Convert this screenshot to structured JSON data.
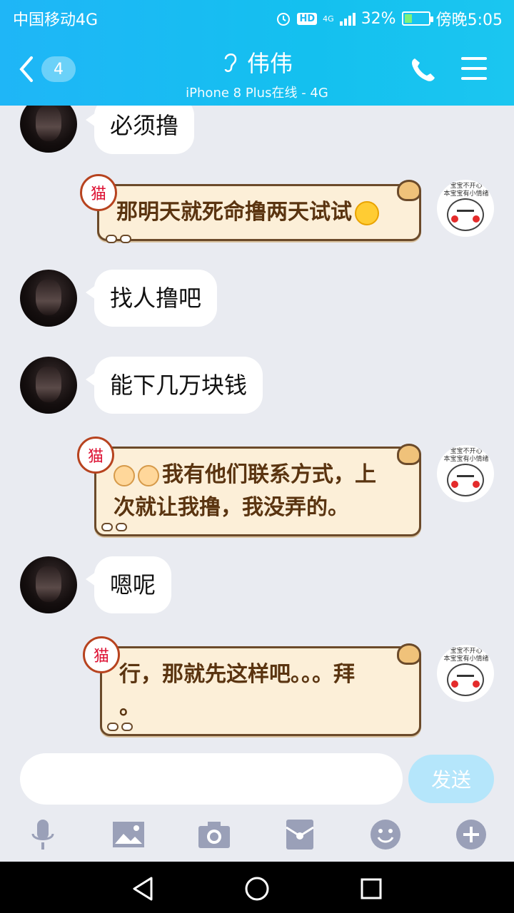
{
  "status_bar": {
    "carrier": "中国移动4G",
    "network": "4G",
    "battery": "32%",
    "battery_level": 0.32,
    "time": "傍晚5:05",
    "hd": "HD"
  },
  "header": {
    "back_count": "4",
    "contact_name": "伟伟",
    "status": "iPhone 8 Plus在线 - 4G"
  },
  "messages": [
    {
      "from": "them",
      "text": "必须撸"
    },
    {
      "from": "me",
      "lines": [
        "那明天就死命撸两天试试"
      ]
    },
    {
      "from": "them",
      "text": "找人撸吧"
    },
    {
      "from": "them",
      "text": "能下几万块钱"
    },
    {
      "from": "me",
      "lines": [
        "我有他们联系方式，上",
        "次就让我撸，我没弄的。"
      ]
    },
    {
      "from": "them",
      "text": "嗯呢"
    },
    {
      "from": "me",
      "lines": [
        "行，那就先这样吧。。。拜",
        "。"
      ]
    }
  ],
  "my_avatar_caption": [
    "宝宝不开心",
    "本宝宝有小情绪"
  ],
  "input": {
    "placeholder": "",
    "send_label": "发送"
  },
  "toolbar": [
    "microphone-icon",
    "image-icon",
    "camera-icon",
    "red-packet-icon",
    "emoji-icon",
    "plus-icon"
  ],
  "colors": {
    "header": "#1bbdf4",
    "send_disabled": "#b5e6fb",
    "bubble_out_bg": "#fcefd8",
    "bubble_out_text": "#5a3410"
  }
}
